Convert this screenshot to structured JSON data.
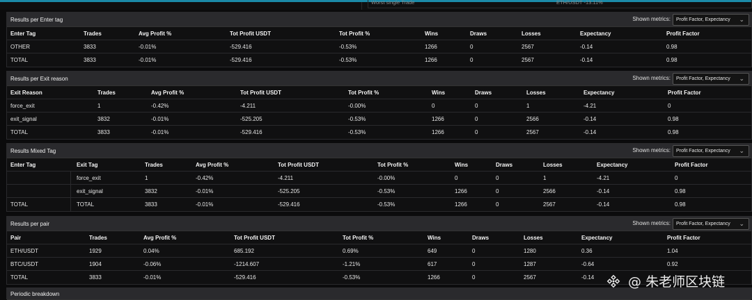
{
  "top": {
    "left_text": "Worst single Trade",
    "right_text": "ETH/USDT -13.11%"
  },
  "sections": {
    "enter_tag": {
      "title": "Results per Enter tag",
      "metrics_label": "Shown metrics:",
      "metrics_value": "Profit Factor, Expectancy",
      "headers": [
        "Enter Tag",
        "Trades",
        "Avg Profit %",
        "Tot Profit USDT",
        "Tot Profit %",
        "Wins",
        "Draws",
        "Losses",
        "Expectancy",
        "Profit Factor"
      ],
      "rows": [
        [
          "OTHER",
          "3833",
          "-0.01%",
          "-529.416",
          "-0.53%",
          "1266",
          "0",
          "2567",
          "-0.14",
          "0.98"
        ],
        [
          "TOTAL",
          "3833",
          "-0.01%",
          "-529.416",
          "-0.53%",
          "1266",
          "0",
          "2567",
          "-0.14",
          "0.98"
        ]
      ]
    },
    "exit_reason": {
      "title": "Results per Exit reason",
      "metrics_label": "Shown metrics:",
      "metrics_value": "Profit Factor, Expectancy",
      "headers": [
        "Exit Reason",
        "Trades",
        "Avg Profit %",
        "Tot Profit USDT",
        "Tot Profit %",
        "Wins",
        "Draws",
        "Losses",
        "Expectancy",
        "Profit Factor"
      ],
      "rows": [
        [
          "force_exit",
          "1",
          "-0.42%",
          "-4.211",
          "-0.00%",
          "0",
          "0",
          "1",
          "-4.21",
          "0"
        ],
        [
          "exit_signal",
          "3832",
          "-0.01%",
          "-525.205",
          "-0.53%",
          "1266",
          "0",
          "2566",
          "-0.14",
          "0.98"
        ],
        [
          "TOTAL",
          "3833",
          "-0.01%",
          "-529.416",
          "-0.53%",
          "1266",
          "0",
          "2567",
          "-0.14",
          "0.98"
        ]
      ]
    },
    "mixed_tag": {
      "title": "Results Mixed Tag",
      "metrics_label": "Shown metrics:",
      "metrics_value": "Profit Factor, Expectancy",
      "headers": [
        "Enter Tag",
        "Exit Tag",
        "Trades",
        "Avg Profit %",
        "Tot Profit USDT",
        "Tot Profit %",
        "Wins",
        "Draws",
        "Losses",
        "Expectancy",
        "Profit Factor"
      ],
      "rows": [
        [
          "",
          "force_exit",
          "1",
          "-0.42%",
          "-4.211",
          "-0.00%",
          "0",
          "0",
          "1",
          "-4.21",
          "0"
        ],
        [
          "",
          "exit_signal",
          "3832",
          "-0.01%",
          "-525.205",
          "-0.53%",
          "1266",
          "0",
          "2566",
          "-0.14",
          "0.98"
        ],
        [
          "TOTAL",
          "TOTAL",
          "3833",
          "-0.01%",
          "-529.416",
          "-0.53%",
          "1266",
          "0",
          "2567",
          "-0.14",
          "0.98"
        ]
      ]
    },
    "pair": {
      "title": "Results per pair",
      "metrics_label": "Shown metrics:",
      "metrics_value": "Profit Factor, Expectancy",
      "headers": [
        "Pair",
        "Trades",
        "Avg Profit %",
        "Tot Profit USDT",
        "Tot Profit %",
        "Wins",
        "Draws",
        "Losses",
        "Expectancy",
        "Profit Factor"
      ],
      "rows": [
        [
          "ETH/USDT",
          "1929",
          "0.04%",
          "685.192",
          "0.69%",
          "649",
          "0",
          "1280",
          "0.36",
          "1.04"
        ],
        [
          "BTC/USDT",
          "1904",
          "-0.06%",
          "-1214.607",
          "-1.21%",
          "617",
          "0",
          "1287",
          "-0.64",
          "0.92"
        ],
        [
          "TOTAL",
          "3833",
          "-0.01%",
          "-529.416",
          "-0.53%",
          "1266",
          "0",
          "2567",
          "-0.14",
          ""
        ]
      ]
    },
    "periodic": {
      "title": "Periodic breakdown"
    }
  },
  "watermark": {
    "text": "@ 朱老师区块链",
    "logo_icon": "binance-square-icon"
  },
  "colors": {
    "accent": "#1b8aa8",
    "header_bg": "#2a2a2d",
    "panel_bg": "#101011"
  }
}
